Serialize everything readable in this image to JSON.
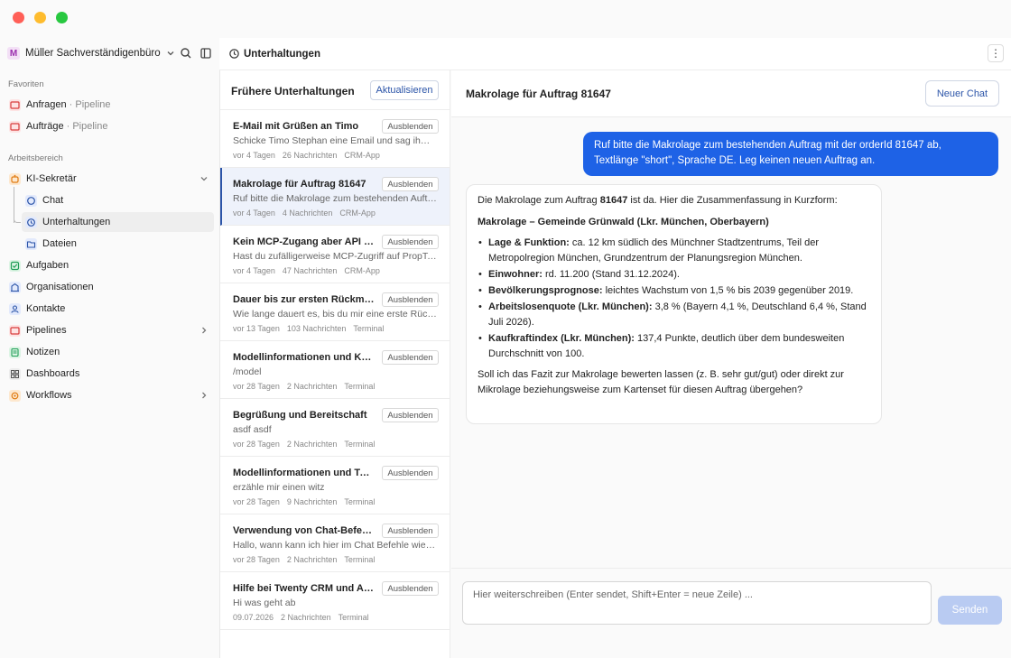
{
  "sidebar": {
    "workspace": {
      "initial": "M",
      "name": "Müller Sachverständigenbüro"
    },
    "favorites_label": "Favoriten",
    "favorites": [
      {
        "label": "Anfragen",
        "sub": "· Pipeline"
      },
      {
        "label": "Aufträge",
        "sub": "· Pipeline"
      }
    ],
    "workspace_label": "Arbeitsbereich",
    "items": [
      {
        "label": "KI-Sekretär"
      },
      {
        "label": "Chat"
      },
      {
        "label": "Unterhaltungen"
      },
      {
        "label": "Dateien"
      },
      {
        "label": "Aufgaben"
      },
      {
        "label": "Organisationen"
      },
      {
        "label": "Kontakte"
      },
      {
        "label": "Pipelines"
      },
      {
        "label": "Notizen"
      },
      {
        "label": "Dashboards"
      },
      {
        "label": "Workflows"
      }
    ]
  },
  "header": {
    "title": "Unterhaltungen",
    "more": "⋮"
  },
  "list": {
    "title": "Frühere Unterhaltungen",
    "refresh_label": "Aktualisieren",
    "hide_label": "Ausblenden",
    "conversations": [
      {
        "title": "E-Mail mit Grüßen an Timo",
        "preview": "Schicke Timo Stephan eine Email und sag ihm liebe Grüße",
        "age": "vor 4 Tagen",
        "count": "26 Nachrichten",
        "source": "CRM-App"
      },
      {
        "title": "Makrolage für Auftrag 81647",
        "preview": "Ruf bitte die Makrolage zum bestehenden Auftrag mit der orderId",
        "age": "vor 4 Tagen",
        "count": "4 Nachrichten",
        "source": "CRM-App"
      },
      {
        "title": "Kein MCP-Zugang aber API verfügbar",
        "preview": "Hast du zufälligerweise MCP-Zugriff auf PropTech?",
        "age": "vor 4 Tagen",
        "count": "47 Nachrichten",
        "source": "CRM-App"
      },
      {
        "title": "Dauer bis zur ersten Rückmeldung",
        "preview": "Wie lange dauert es, bis du mir eine erste Rückmeldung gibst?",
        "age": "vor 13 Tagen",
        "count": "103 Nachrichten",
        "source": "Terminal"
      },
      {
        "title": "Modellinformationen und Konfiguration",
        "preview": "/model",
        "age": "vor 28 Tagen",
        "count": "2 Nachrichten",
        "source": "Terminal"
      },
      {
        "title": "Begrüßung und Bereitschaft",
        "preview": "asdf asdf",
        "age": "vor 28 Tagen",
        "count": "2 Nachrichten",
        "source": "Terminal"
      },
      {
        "title": "Modellinformationen und Tweaks",
        "preview": "erzähle mir einen witz",
        "age": "vor 28 Tagen",
        "count": "9 Nachrichten",
        "source": "Terminal"
      },
      {
        "title": "Verwendung von Chat-Befehlen",
        "preview": "Hallo, wann kann ich hier im Chat Befehle wie /new nutzen?",
        "age": "vor 28 Tagen",
        "count": "2 Nachrichten",
        "source": "Terminal"
      },
      {
        "title": "Hilfe bei Twenty CRM und Anfragen",
        "preview": "Hi was geht ab",
        "age": "09.07.2026",
        "count": "2 Nachrichten",
        "source": "Terminal"
      }
    ]
  },
  "chat": {
    "title": "Makrolage für Auftrag 81647",
    "new_chat_label": "Neuer Chat",
    "user_message": "Ruf bitte die Makrolage zum bestehenden Auftrag mit der orderId 81647 ab, Textlänge \"short\", Sprache DE. Leg keinen neuen Auftrag an.",
    "bot": {
      "intro_a": "Die Makrolage zum Auftrag ",
      "intro_order": "81647",
      "intro_b": " ist da. Hier die Zusammenfassung in Kurzform:",
      "heading": "Makrolage – Gemeinde Grünwald (Lkr. München, Oberbayern)",
      "bullets": [
        {
          "key": "Lage & Funktion:",
          "text": " ca. 12 km südlich des Münchner Stadtzentrums, Teil der Metropolregion München, Grundzentrum der Planungsregion München."
        },
        {
          "key": "Einwohner:",
          "text": " rd. 11.200 (Stand 31.12.2024)."
        },
        {
          "key": "Bevölkerungsprognose:",
          "text": " leichtes Wachstum von 1,5 % bis 2039 gegenüber 2019."
        },
        {
          "key": "Arbeitslosenquote (Lkr. München):",
          "text": " 3,8 % (Bayern 4,1 %, Deutschland 6,4 %, Stand Juli 2026)."
        },
        {
          "key": "Kaufkraftindex (Lkr. München):",
          "text": " 137,4 Punkte, deutlich über dem bundesweiten Durchschnitt von 100."
        }
      ],
      "closing": "Soll ich das Fazit zur Makrolage bewerten lassen (z. B. sehr gut/gut) oder direkt zur Mikrolage beziehungsweise zum Kartenset für diesen Auftrag übergehen?"
    },
    "composer": {
      "placeholder": "Hier weiterschreiben (Enter sendet, Shift+Enter = neue Zeile) ...",
      "send_label": "Senden"
    }
  },
  "colors": {
    "accent": "#1e62e6",
    "link": "#2b54a8",
    "send_disabled": "#b9cbf2"
  }
}
